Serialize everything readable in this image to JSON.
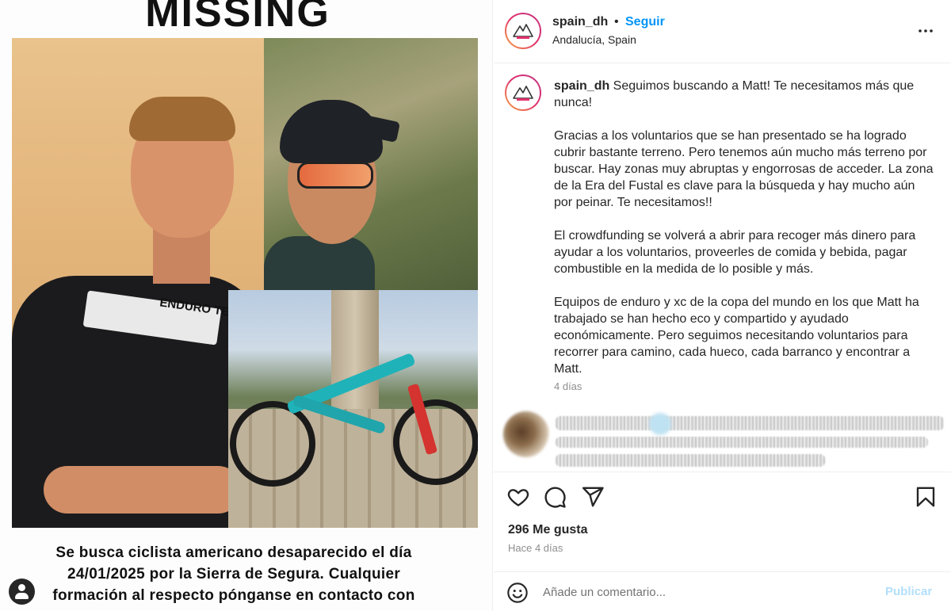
{
  "poster": {
    "title": "MISSING",
    "shirt_text": "ENDURO TEAM",
    "body_text": "Se busca ciclista americano desaparecido el día\n24/01/2025 por la Sierra de Segura. Cualquier\nformación al respecto pónganse en contacto con"
  },
  "post": {
    "username": "spain_dh",
    "separator": "•",
    "follow_label": "Seguir",
    "location": "Andalucía, Spain",
    "more_icon": "more-horizontal-icon",
    "caption_user": "spain_dh",
    "caption_text": " Seguimos buscando a Matt! Te necesitamos más que nunca!\n\nGracias a los voluntarios que se han presentado se ha logrado cubrir bastante terreno. Pero tenemos aún mucho más terreno por buscar. Hay zonas muy abruptas y engorrosas de acceder. La zona de la Era del Fustal es clave para la búsqueda y hay mucho aún por peinar. Te necesitamos!!\n\nEl crowdfunding se volverá a abrir para recoger más dinero para ayudar a los voluntarios, proveerles de comida y bebida, pagar combustible en la medida de lo posible y más.\n\nEquipos de enduro y xc de la copa del mundo en los que Matt ha trabajado se han hecho eco y compartido y ayudado económicamente. Pero seguimos necesitando voluntarios para recorrer para camino, cada hueco, cada barranco y encontrar a Matt.",
    "caption_time": "4 días",
    "likes": "296 Me gusta",
    "posted_ago": "Hace 4 días",
    "comment_placeholder": "Añade un comentario...",
    "post_button": "Publicar"
  },
  "colors": {
    "link_blue": "#0095f6",
    "muted": "#8e8e8e",
    "text": "#262626",
    "publish_disabled": "#b2dffc"
  }
}
